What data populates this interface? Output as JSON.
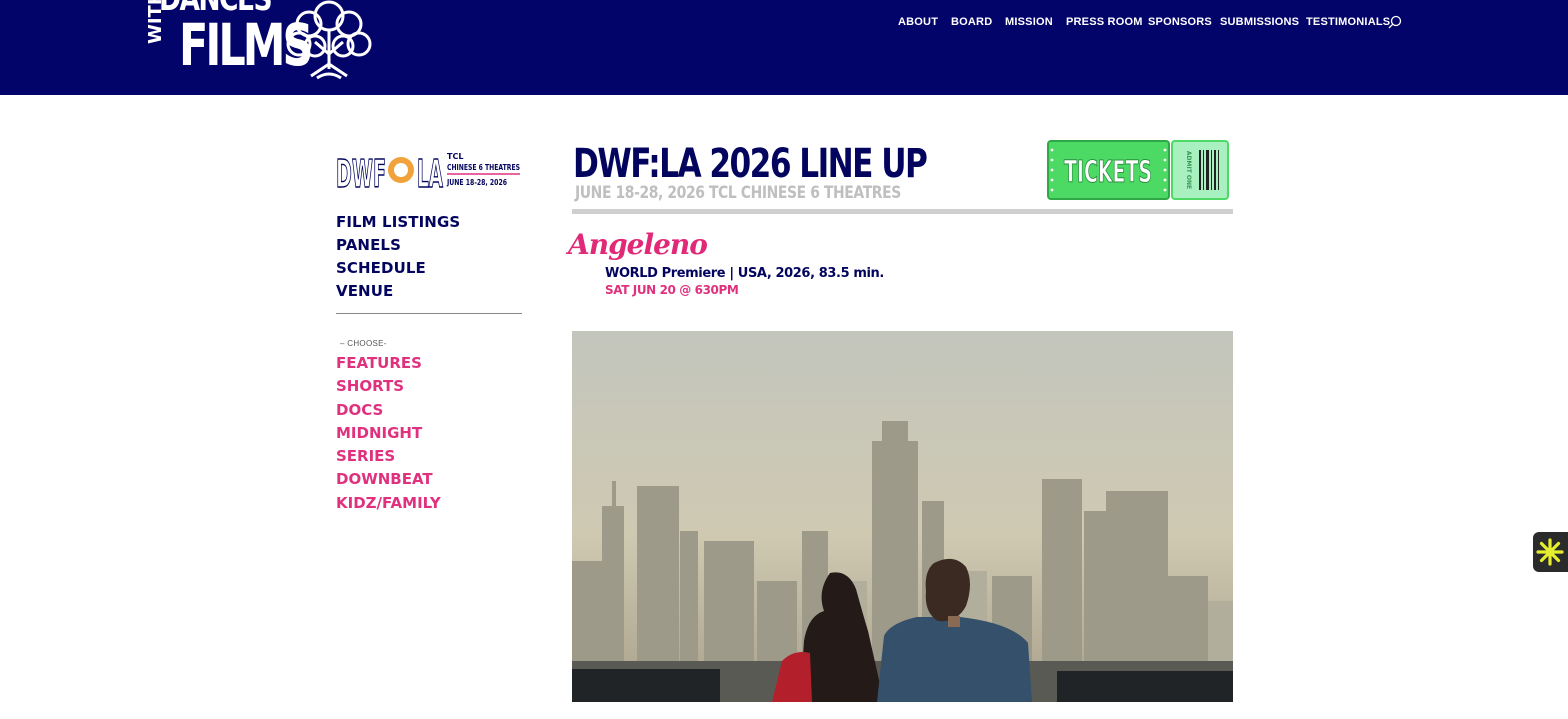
{
  "header": {
    "logo_words": [
      "DANCES",
      "WITH",
      "FILMS"
    ],
    "nav": [
      {
        "label": "ABOUT"
      },
      {
        "label": "BOARD"
      },
      {
        "label": "MISSION"
      },
      {
        "label": "PRESS ROOM"
      },
      {
        "label": "SPONSORS"
      },
      {
        "label": "SUBMISSIONS"
      },
      {
        "label": "TESTIMONIALS"
      }
    ],
    "search_icon": "search-icon",
    "colors": {
      "bar": "#03046a",
      "text": "#ffffff"
    }
  },
  "sidebar": {
    "logo": {
      "main": "DWF",
      "la": "LA",
      "line1": "TCL",
      "line2": "CHINESE 6 THEATRES",
      "line3": "JUNE 18-28, 2026"
    },
    "menu": [
      {
        "label": "FILM LISTINGS"
      },
      {
        "label": "PANELS"
      },
      {
        "label": "SCHEDULE"
      },
      {
        "label": "VENUE"
      }
    ],
    "choose_label": "– CHOOSE-",
    "categories": [
      {
        "label": "FEATURES"
      },
      {
        "label": "SHORTS"
      },
      {
        "label": "DOCS"
      },
      {
        "label": "MIDNIGHT"
      },
      {
        "label": "SERIES"
      },
      {
        "label": "DOWNBEAT"
      },
      {
        "label": "KIDZ/FAMILY"
      }
    ]
  },
  "main": {
    "title": "DWF:LA 2026 LINE UP",
    "subtitle": "JUNE 18-28, 2026 TCL CHINESE 6 THEATRES",
    "tickets": {
      "label": "TICKETS",
      "stub_label": "ADMIT ONE"
    },
    "film": {
      "title": "Angeleno",
      "meta": "WORLD Premiere | USA, 2026, 83.5 min.",
      "showtime": "SAT JUN 20 @ 630PM"
    }
  },
  "colors": {
    "navy": "#03045e",
    "pink": "#e0317e",
    "ticket_green": "#4cd964"
  },
  "widget": {
    "icon": "asterisk-icon"
  }
}
